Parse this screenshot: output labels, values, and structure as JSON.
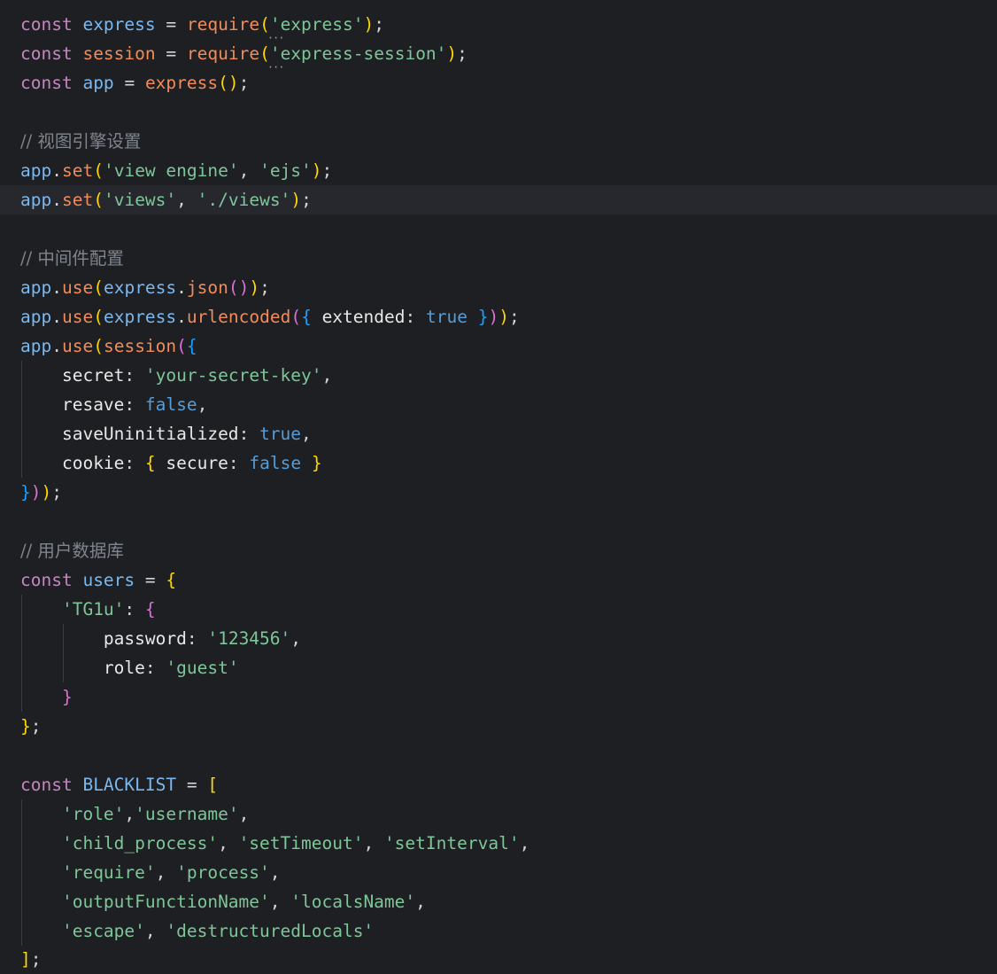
{
  "editor": {
    "language": "javascript",
    "current_line": 7,
    "comments": {
      "view_engine": "// 视图引擎设置",
      "middleware": "// 中间件配置",
      "user_db": "// 用户数据库"
    },
    "strings": {
      "express": "'express'",
      "express_session": "'express-session'",
      "view_engine": "'view engine'",
      "ejs": "'ejs'",
      "views": "'views'",
      "views_path": "'./views'",
      "secret_value": "'your-secret-key'",
      "user_key": "'TG1u'",
      "password_value": "'123456'",
      "role_value": "'guest'",
      "bl_role": "'role'",
      "bl_username": "'username'",
      "bl_child_process": "'child_process'",
      "bl_setTimeout": "'setTimeout'",
      "bl_setInterval": "'setInterval'",
      "bl_require": "'require'",
      "bl_process": "'process'",
      "bl_outputFunctionName": "'outputFunctionName'",
      "bl_localsName": "'localsName'",
      "bl_escape": "'escape'",
      "bl_destructuredLocals": "'destructuredLocals'"
    },
    "idents": {
      "const": "const",
      "express": "express",
      "session": "session",
      "app": "app",
      "require": "require",
      "set": "set",
      "use": "use",
      "json": "json",
      "urlencoded": "urlencoded",
      "extended": "extended",
      "secret": "secret",
      "resave": "resave",
      "saveUninitialized": "saveUninitialized",
      "cookie": "cookie",
      "secure": "secure",
      "users": "users",
      "password": "password",
      "role": "role",
      "BLACKLIST": "BLACKLIST",
      "true": "true",
      "false": "false"
    }
  }
}
